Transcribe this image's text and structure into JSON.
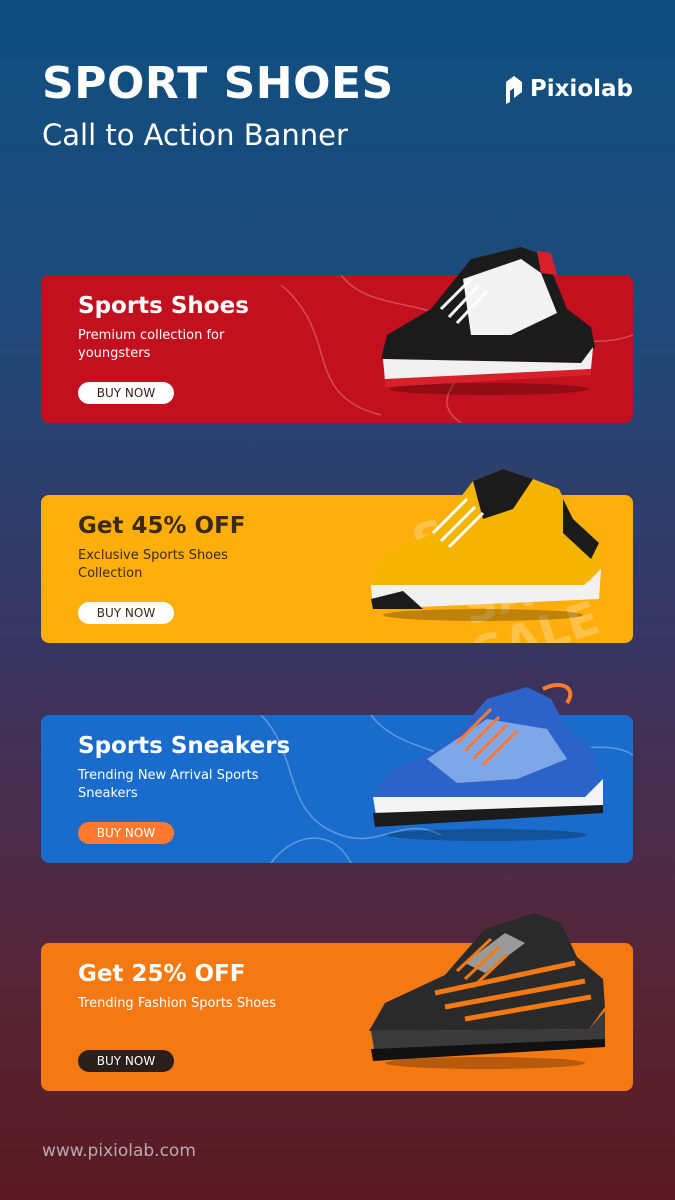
{
  "header": {
    "title": "SPORT SHOES",
    "subtitle": "Call to Action Banner"
  },
  "brand": {
    "name": "Pixiolab",
    "logo_icon": "pixiolab-logo-icon"
  },
  "banners": [
    {
      "heading": "Sports Shoes",
      "description": "Premium collection for youngsters",
      "button": "BUY NOW",
      "background": "#c3101e",
      "button_bg": "#ffffff",
      "button_color": "#3a1a1a",
      "shoe_icon": "sneaker-icon"
    },
    {
      "heading": "Get 45% OFF",
      "description": "Exclusive Sports Shoes Collection",
      "button": "BUY NOW",
      "background": "#ffae0c",
      "button_bg": "#ffffff",
      "button_color": "#3a2a10",
      "sale_words": [
        "SALE",
        "SALE",
        "SALE"
      ],
      "shoe_icon": "sneaker-icon"
    },
    {
      "heading": "Sports Sneakers",
      "description": "Trending New Arrival Sports Sneakers",
      "button": "BUY NOW",
      "background": "#1a6ccc",
      "button_bg": "#ff7a2e",
      "button_color": "#ffffff",
      "shoe_icon": "sneaker-icon"
    },
    {
      "heading": "Get 25% OFF",
      "description": "Trending Fashion Sports Shoes",
      "button": "BUY NOW",
      "background": "#f57913",
      "button_bg": "#2a1f1a",
      "button_color": "#ffffff",
      "shoe_icon": "sneaker-icon"
    }
  ],
  "footer": {
    "url": "www.pixiolab.com"
  }
}
